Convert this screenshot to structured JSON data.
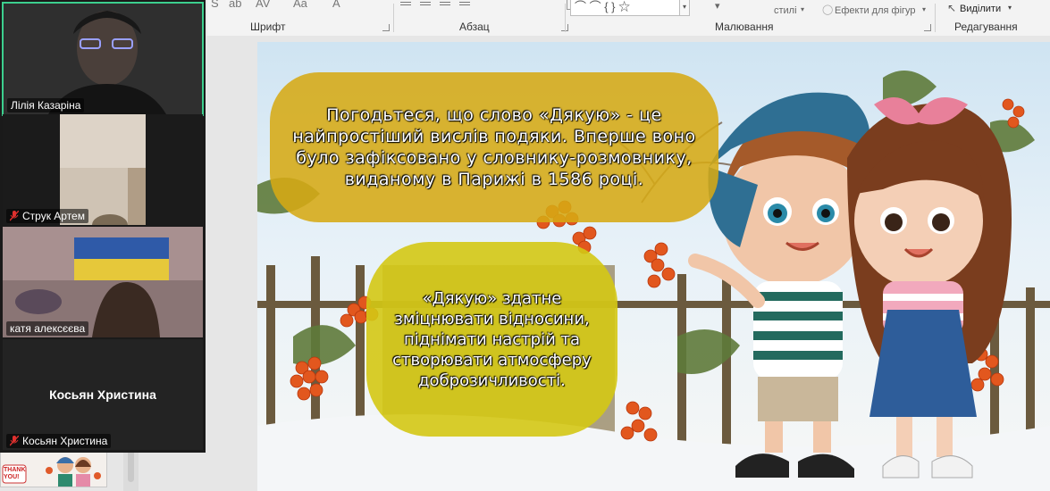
{
  "ribbon": {
    "groups": {
      "font": "Шрифт",
      "paragraph": "Абзац",
      "drawing": "Малювання",
      "editing": "Редагування"
    },
    "styles_label": "стилі",
    "shape_effects_label": "Ефекти для фігур",
    "select_label": "Виділити"
  },
  "participants": [
    {
      "name": "Лілія Казаріна",
      "muted": false,
      "active": true
    },
    {
      "name": "Струк Артем",
      "muted": true,
      "active": false
    },
    {
      "name": "катя алексєєва",
      "muted": false,
      "active": false
    },
    {
      "name": "Косьян Христина",
      "muted": true,
      "active": false,
      "display_name": "Косьян Христина"
    }
  ],
  "thumbnail": {
    "text": "THANK YOU!"
  },
  "slide": {
    "bubble1_text": "Погодьтеся, що слово «Дякую» - це найпростіший вислів подяки. Вперше воно було зафіксовано у словнику-розмовнику, виданому в Парижі в 1586 році.",
    "bubble2_text": "«Дякую» здатне зміцнювати відносини, піднімати настрій та створювати атмосферу доброзичливості."
  },
  "colors": {
    "active_speaker_border": "#3ccf8e",
    "mic_off": "#e0302e",
    "bubble1": "#d6aa14",
    "bubble2": "#d4c814"
  }
}
